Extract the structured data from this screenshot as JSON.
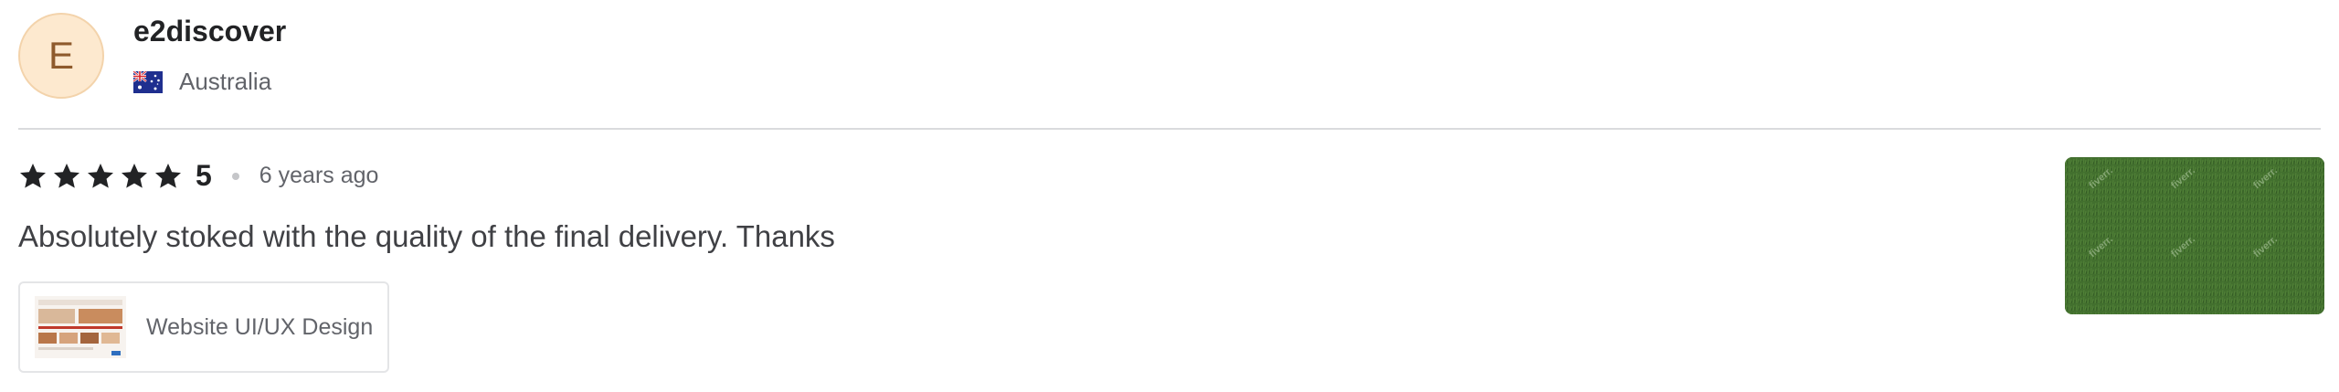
{
  "reviewer": {
    "avatar_initial": "E",
    "name": "e2discover",
    "country": "Australia",
    "flag_icon": "australia-flag-icon"
  },
  "review": {
    "rating": "5",
    "stars_filled": 5,
    "time_ago": "6 years ago",
    "comment": "Absolutely stoked with the quality of the final delivery. Thanks"
  },
  "gig": {
    "title": "Website UI/UX Design"
  },
  "delivery_image": {
    "watermark": "fiverr."
  },
  "colors": {
    "avatar_bg": "#fde9cf",
    "avatar_text": "#8e5a2c",
    "star": "#222325",
    "divider": "#dadbdd",
    "grass": "#3f6a2e"
  }
}
